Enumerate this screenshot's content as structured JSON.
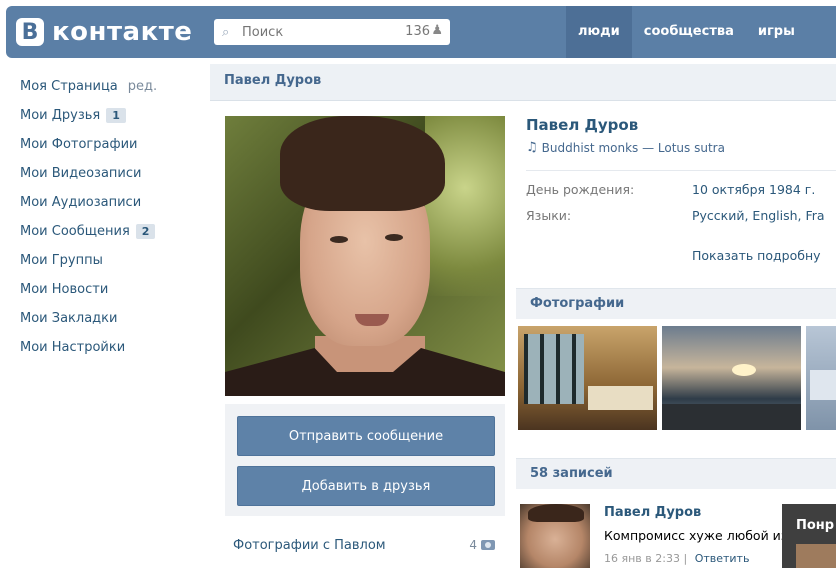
{
  "colors": {
    "header_bg": "#5b7fa6",
    "link": "#2b587a",
    "button": "#5e82a8",
    "section_bg": "#eef1f5"
  },
  "header": {
    "logo_mark": "В",
    "logo_text": "контакте",
    "search": {
      "placeholder": "Поиск",
      "count": "136",
      "icon": "search-icon",
      "count_icon": "person-icon"
    },
    "nav": [
      "люди",
      "сообщества",
      "игры"
    ]
  },
  "left_menu": {
    "items": [
      {
        "label": "Моя Страница",
        "extra": "ред."
      },
      {
        "label": "Мои Друзья",
        "badge": "1"
      },
      {
        "label": "Мои Фотографии"
      },
      {
        "label": "Мои Видеозаписи"
      },
      {
        "label": "Мои Аудиозаписи"
      },
      {
        "label": "Мои Сообщения",
        "badge": "2"
      },
      {
        "label": "Мои Группы"
      },
      {
        "label": "Мои Новости"
      },
      {
        "label": "Мои Закладки"
      },
      {
        "label": "Мои Настройки"
      }
    ]
  },
  "page": {
    "title": "Павел Дуров"
  },
  "profile": {
    "name": "Павел Дуров",
    "status": "Buddhist monks — Lotus sutra",
    "birthday_label": "День рождения:",
    "birthday_value": "10 октября 1984 г.",
    "languages_label": "Языки:",
    "languages_value": "Русский, English, Fra",
    "show_more": "Показать подробну"
  },
  "actions": {
    "send_message": "Отправить сообщение",
    "add_friend": "Добавить в друзья"
  },
  "photos_with": {
    "label": "Фотографии с Павлом",
    "count": "4"
  },
  "sections": {
    "photos_title": "Фотографии",
    "wall_title": "58 записей"
  },
  "post": {
    "author": "Павел Дуров",
    "text": "Компромисс хуже любой из альт",
    "time": "16 янв в 2:33",
    "separator": "|",
    "reply": "Ответить"
  },
  "tooltip": {
    "text": "Понр"
  }
}
